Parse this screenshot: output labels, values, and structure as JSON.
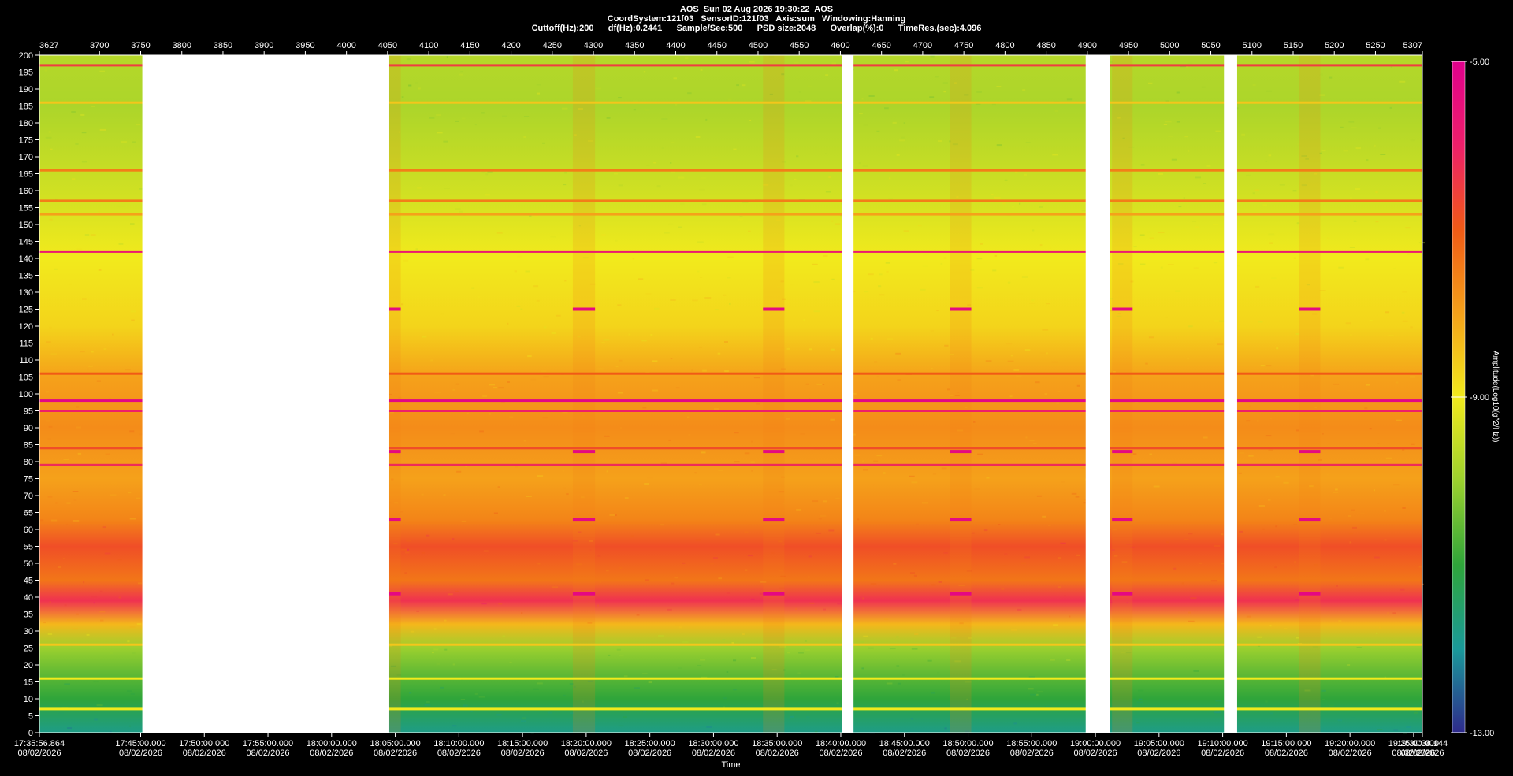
{
  "header": {
    "line1": "AOS  Sun 02 Aug 2026 19:30:22  AOS",
    "line2": "CoordSystem:121f03   SensorID:121f03   Axis:sum   Windowing:Hanning",
    "line3": "Cuttoff(Hz):200      df(Hz):0.2441      Sample/Sec:500      PSD size:2048      Overlap(%):0      TimeRes.(sec):4.096"
  },
  "chart_data": {
    "type": "heatmap",
    "title": "AOS  Sun 02 Aug 2026 19:30:22  AOS",
    "xlabel": "Time",
    "ylabel": "",
    "colorbar_label": "Amplitude(Log10(g^2/Hz))",
    "colorbar_ticks": [
      "-5.00",
      "-9.00",
      "-13.00"
    ],
    "colorbar_range": [
      -13,
      -5
    ],
    "ylim": [
      0,
      200
    ],
    "y_ticks": [
      200,
      195,
      190,
      185,
      180,
      175,
      170,
      165,
      160,
      155,
      150,
      145,
      140,
      135,
      130,
      125,
      120,
      115,
      110,
      105,
      100,
      95,
      90,
      85,
      80,
      75,
      70,
      65,
      60,
      55,
      50,
      45,
      40,
      35,
      30,
      25,
      20,
      15,
      10,
      5,
      0
    ],
    "xlim": [
      3627,
      5307
    ],
    "top_ticks": [
      "3627",
      "3700",
      "3750",
      "3800",
      "3850",
      "3900",
      "3950",
      "4000",
      "4050",
      "4100",
      "4150",
      "4200",
      "4250",
      "4300",
      "4350",
      "4400",
      "4450",
      "4500",
      "4550",
      "4600",
      "4650",
      "4700",
      "4750",
      "4800",
      "4850",
      "4900",
      "4950",
      "5000",
      "5050",
      "5100",
      "5150",
      "5200",
      "5250",
      "5307"
    ],
    "time_ticks": [
      {
        "time": "17:35:56.864",
        "date": "08/02/2026"
      },
      {
        "time": "17:45:00.000",
        "date": "08/02/2026"
      },
      {
        "time": "17:50:00.000",
        "date": "08/02/2026"
      },
      {
        "time": "17:55:00.000",
        "date": "08/02/2026"
      },
      {
        "time": "18:00:00.000",
        "date": "08/02/2026"
      },
      {
        "time": "18:05:00.000",
        "date": "08/02/2026"
      },
      {
        "time": "18:10:00.000",
        "date": "08/02/2026"
      },
      {
        "time": "18:15:00.000",
        "date": "08/02/2026"
      },
      {
        "time": "18:20:00.000",
        "date": "08/02/2026"
      },
      {
        "time": "18:25:00.000",
        "date": "08/02/2026"
      },
      {
        "time": "18:30:00.000",
        "date": "08/02/2026"
      },
      {
        "time": "18:35:00.000",
        "date": "08/02/2026"
      },
      {
        "time": "18:40:00.000",
        "date": "08/02/2026"
      },
      {
        "time": "18:45:00.000",
        "date": "08/02/2026"
      },
      {
        "time": "18:50:00.000",
        "date": "08/02/2026"
      },
      {
        "time": "18:55:00.000",
        "date": "08/02/2026"
      },
      {
        "time": "19:00:00.000",
        "date": "08/02/2026"
      },
      {
        "time": "19:05:00.000",
        "date": "08/02/2026"
      },
      {
        "time": "19:10:00.000",
        "date": "08/02/2026"
      },
      {
        "time": "19:15:00.000",
        "date": "08/02/2026"
      },
      {
        "time": "19:20:00.000",
        "date": "08/02/2026"
      },
      {
        "time": "19:25:00.000",
        "date": "08/02/2026"
      },
      {
        "time": "19:30:38.144",
        "date": "08/02/2026"
      }
    ],
    "data_gaps": [
      [
        3752,
        4052
      ],
      [
        4602,
        4616
      ],
      [
        4898,
        4927
      ],
      [
        5066,
        5082
      ]
    ],
    "tonal_lines_hz": [
      {
        "hz": 197,
        "level": -6.5
      },
      {
        "hz": 186,
        "level": -8.5
      },
      {
        "hz": 166,
        "level": -7.5
      },
      {
        "hz": 157,
        "level": -7.5
      },
      {
        "hz": 153,
        "level": -8.0
      },
      {
        "hz": 142,
        "level": -5.8
      },
      {
        "hz": 106,
        "level": -7.0
      },
      {
        "hz": 98,
        "level": -5.2
      },
      {
        "hz": 95,
        "level": -6.0
      },
      {
        "hz": 84,
        "level": -6.8
      },
      {
        "hz": 79,
        "level": -6.2
      },
      {
        "hz": 62,
        "level": -7.5
      },
      {
        "hz": 26,
        "level": -8.5
      },
      {
        "hz": 16,
        "level": -9.0
      },
      {
        "hz": 7,
        "level": -9.0
      }
    ],
    "broadband_profile": [
      {
        "hz": 0,
        "level": -11.8
      },
      {
        "hz": 10,
        "level": -11.0
      },
      {
        "hz": 18,
        "level": -10.5
      },
      {
        "hz": 25,
        "level": -10.0
      },
      {
        "hz": 32,
        "level": -8.3
      },
      {
        "hz": 39,
        "level": -6.3
      },
      {
        "hz": 45,
        "level": -7.4
      },
      {
        "hz": 55,
        "level": -6.8
      },
      {
        "hz": 63,
        "level": -7.6
      },
      {
        "hz": 75,
        "level": -8.0
      },
      {
        "hz": 90,
        "level": -7.7
      },
      {
        "hz": 105,
        "level": -8.0
      },
      {
        "hz": 120,
        "level": -8.7
      },
      {
        "hz": 140,
        "level": -9.0
      },
      {
        "hz": 160,
        "level": -9.4
      },
      {
        "hz": 185,
        "level": -9.8
      },
      {
        "hz": 200,
        "level": -9.7
      }
    ],
    "events": [
      {
        "start": 4052,
        "end": 4066,
        "band_hz": [
          0,
          200
        ],
        "level": -5.3
      },
      {
        "start": 4275,
        "end": 4302,
        "band_hz": [
          0,
          200
        ],
        "level": -5.3
      },
      {
        "start": 4506,
        "end": 4532,
        "band_hz": [
          0,
          200
        ],
        "level": -5.3
      },
      {
        "start": 4733,
        "end": 4759,
        "band_hz": [
          0,
          200
        ],
        "level": -5.3
      },
      {
        "start": 4930,
        "end": 4955,
        "band_hz": [
          0,
          200
        ],
        "level": -5.3
      },
      {
        "start": 5157,
        "end": 5183,
        "band_hz": [
          0,
          200
        ],
        "level": -5.3
      }
    ],
    "event_tones_hz": [
      125,
      83,
      63,
      41
    ],
    "grid": false,
    "legend": "right"
  },
  "colors": {
    "background": "#000000",
    "gap": "#ffffff",
    "colormap": [
      "#2e2a8c",
      "#1a9a9a",
      "#2fa53a",
      "#9bd02e",
      "#f2ea1c",
      "#f5a11a",
      "#f05a16",
      "#ee1f6a",
      "#e0008c"
    ]
  }
}
